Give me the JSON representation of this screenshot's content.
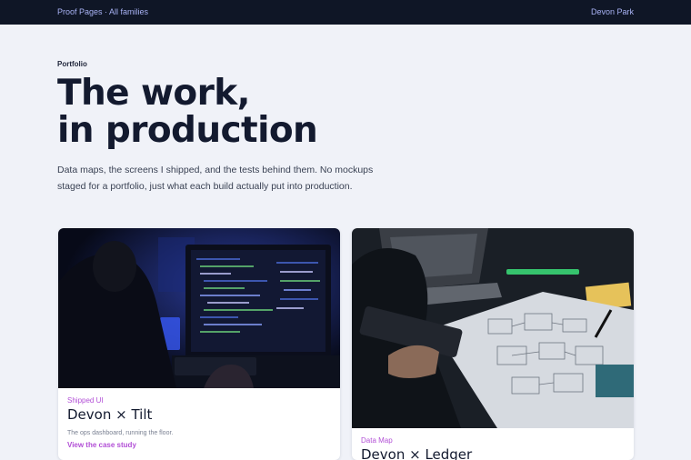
{
  "topbar": {
    "brand": "Proof Pages · All families",
    "user": "Devon Park"
  },
  "hero": {
    "eyebrow": "Portfolio",
    "title_line1": "The work,",
    "title_line2": "in production",
    "intro": "Data maps, the screens I shipped, and the tests behind them. No mockups staged for a portfolio, just what each build actually put into production."
  },
  "cards": [
    {
      "tag": "Shipped UI",
      "title": "Devon × Tilt",
      "description": "The ops dashboard, running the floor.",
      "link": "View the case study"
    },
    {
      "tag": "Data Map",
      "title": "Devon × Ledger"
    }
  ],
  "colors": {
    "topbar": "#0f1626",
    "accent": "#b24fd6",
    "nav_link": "#a9b3f5",
    "page_bg": "#f0f2f8"
  }
}
